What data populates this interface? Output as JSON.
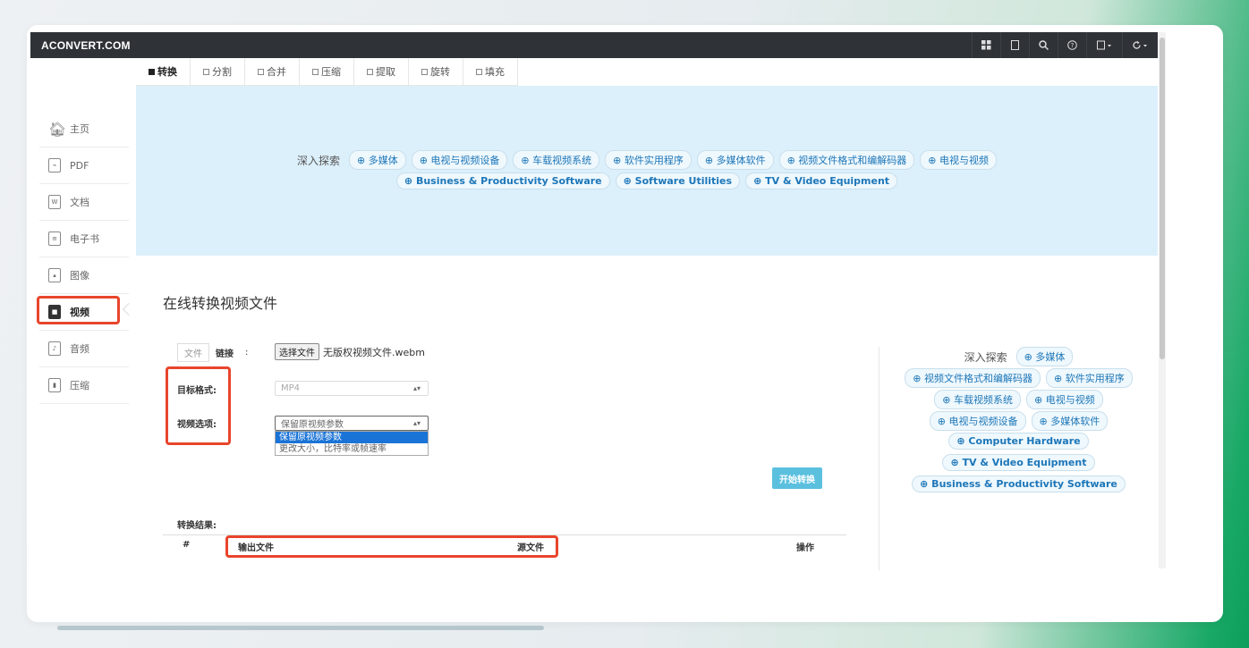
{
  "brand": "ACONVERT.COM",
  "navbar_icons": [
    "grid-icon",
    "tablet-icon",
    "search-icon",
    "help-icon",
    "language-icon",
    "refresh-icon"
  ],
  "tabs": [
    {
      "label": "转换",
      "active": true
    },
    {
      "label": "分割",
      "active": false
    },
    {
      "label": "合并",
      "active": false
    },
    {
      "label": "压缩",
      "active": false
    },
    {
      "label": "提取",
      "active": false
    },
    {
      "label": "旋转",
      "active": false
    },
    {
      "label": "填充",
      "active": false
    }
  ],
  "sidebar": [
    {
      "label": "主页",
      "icon": "home-icon"
    },
    {
      "label": "PDF",
      "icon": "pdf-icon"
    },
    {
      "label": "文档",
      "icon": "document-icon"
    },
    {
      "label": "电子书",
      "icon": "ebook-icon"
    },
    {
      "label": "图像",
      "icon": "image-icon"
    },
    {
      "label": "视频",
      "icon": "video-icon",
      "active": true
    },
    {
      "label": "音频",
      "icon": "audio-icon"
    },
    {
      "label": "压缩",
      "icon": "archive-icon"
    }
  ],
  "banner": {
    "explore_label": "深入探索",
    "line1": [
      "⊕ 多媒体",
      "⊕ 电视与视频设备",
      "⊕ 车载视频系统",
      "⊕ 软件实用程序",
      "⊕ 多媒体软件",
      "⊕ 视频文件格式和编解码器",
      "⊕ 电视与视频"
    ],
    "line2": [
      "⊕ Business & Productivity Software",
      "⊕ Software Utilities",
      "⊕ TV & Video Equipment"
    ]
  },
  "main": {
    "title": "在线转换视频文件",
    "source_tabs": {
      "file": "文件",
      "link": "链接",
      "colon": ":"
    },
    "choose_file_label": "选择文件",
    "file_name": "无版权视频文件.webm",
    "target_format_label": "目标格式:",
    "target_format_value": "MP4",
    "video_options_label": "视频选项:",
    "video_options_value": "保留原视频参数",
    "dropdown_options": [
      "保留原视频参数",
      "更改大小，比特率或帧速率"
    ],
    "start_button": "开始转换",
    "result_label": "转换结果:",
    "table_headers": {
      "index": "#",
      "output": "输出文件",
      "source": "源文件",
      "action": "操作"
    }
  },
  "right_panel": {
    "explore_label": "深入探索",
    "lines": [
      [
        "⊕ 多媒体"
      ],
      [
        "⊕ 视频文件格式和编解码器",
        "⊕ 软件实用程序"
      ],
      [
        "⊕ 车载视频系统",
        "⊕ 电视与视频"
      ],
      [
        "⊕ 电视与视频设备",
        "⊕ 多媒体软件"
      ],
      [
        "⊕ Computer Hardware"
      ],
      [
        "⊕ TV & Video Equipment"
      ],
      [
        "⊕ Business & Productivity Software"
      ]
    ]
  },
  "colors": {
    "highlight": "#e8452c",
    "navbar": "#2f3338",
    "banner": "#dcf0fb",
    "accent": "#5bc0de",
    "link": "#1d76b8"
  }
}
